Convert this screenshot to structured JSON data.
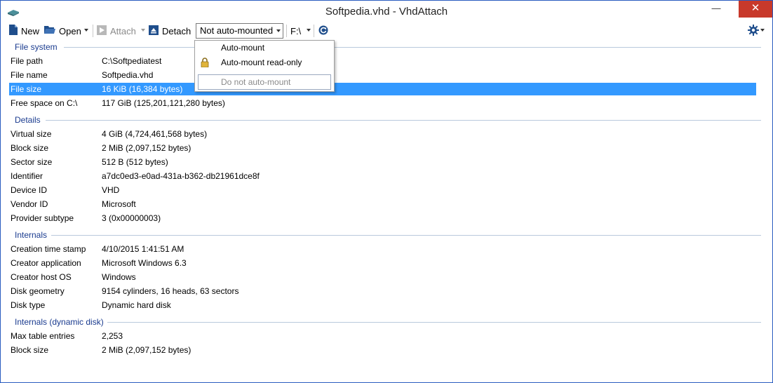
{
  "window": {
    "title": "Softpedia.vhd - VhdAttach"
  },
  "window_controls": {
    "minimize": "—",
    "maximize": "☐",
    "close": "✕"
  },
  "toolbar": {
    "new_label": "New",
    "open_label": "Open",
    "attach_label": "Attach",
    "detach_label": "Detach",
    "automount_combo": "Not auto-mounted",
    "drive_combo": "F:\\"
  },
  "automount_menu": {
    "items": [
      "Auto-mount",
      "Auto-mount read-only",
      "Do not auto-mount"
    ]
  },
  "sections": [
    {
      "title": "File system",
      "rows": [
        {
          "label": "File path",
          "value": "C:\\Softpediatest"
        },
        {
          "label": "File name",
          "value": "Softpedia.vhd"
        },
        {
          "label": "File size",
          "value": "16 KiB (16,384 bytes)"
        },
        {
          "label": "Free space on C:\\",
          "value": "117 GiB (125,201,121,280 bytes)"
        }
      ]
    },
    {
      "title": "Details",
      "rows": [
        {
          "label": "Virtual size",
          "value": "4 GiB (4,724,461,568 bytes)"
        },
        {
          "label": "Block size",
          "value": "2 MiB (2,097,152 bytes)"
        },
        {
          "label": "Sector size",
          "value": "512 B (512 bytes)"
        },
        {
          "label": "Identifier",
          "value": "a7dc0ed3-e0ad-431a-b362-db21961dce8f"
        },
        {
          "label": "Device ID",
          "value": "VHD"
        },
        {
          "label": "Vendor ID",
          "value": "Microsoft"
        },
        {
          "label": "Provider subtype",
          "value": "3 (0x00000003)"
        }
      ]
    },
    {
      "title": "Internals",
      "rows": [
        {
          "label": "Creation time stamp",
          "value": "4/10/2015 1:41:51 AM"
        },
        {
          "label": "Creator application",
          "value": "Microsoft Windows 6.3"
        },
        {
          "label": "Creator host OS",
          "value": "Windows"
        },
        {
          "label": "Disk geometry",
          "value": "9154 cylinders, 16 heads, 63 sectors"
        },
        {
          "label": "Disk type",
          "value": "Dynamic hard disk"
        }
      ]
    },
    {
      "title": "Internals (dynamic disk)",
      "rows": [
        {
          "label": "Max table entries",
          "value": "2,253"
        },
        {
          "label": "Block size",
          "value": "2 MiB (2,097,152 bytes)"
        }
      ]
    }
  ],
  "colors": {
    "selection": "#3399ff",
    "section_header": "#1a3b8f",
    "close_button": "#c8392b"
  },
  "icons": [
    "app-icon",
    "new-document-icon",
    "open-folder-icon",
    "attach-icon",
    "detach-icon",
    "refresh-icon",
    "gear-icon",
    "lock-icon"
  ]
}
